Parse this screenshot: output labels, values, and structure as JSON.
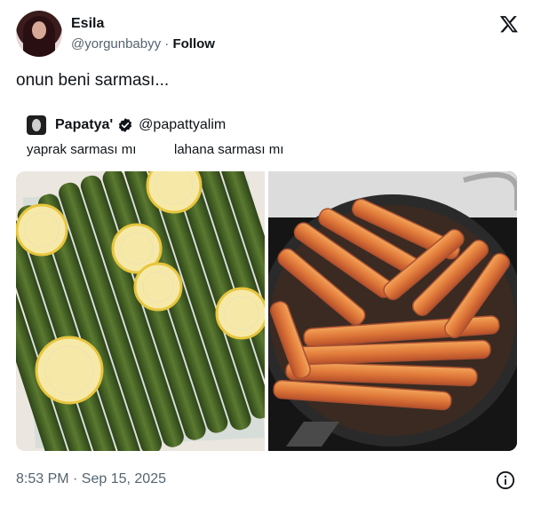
{
  "author": {
    "name": "Esila",
    "handle": "@yorgunbabyy",
    "separator": "·",
    "follow_label": "Follow"
  },
  "icons": {
    "x_logo": "x-logo-icon",
    "verified": "verified-badge-icon",
    "info": "info-icon"
  },
  "tweet": {
    "text": "onun beni sarması..."
  },
  "quoted": {
    "name": "Papatya'",
    "handle": "@papattyalim",
    "caption_left": "yaprak sarması mı",
    "caption_right": "lahana sarması mı"
  },
  "timestamp": "8:53 PM · Sep 15, 2025",
  "colors": {
    "text_primary": "#0f1419",
    "text_secondary": "#536471",
    "grape_leaf_green": "#3f5a22",
    "cabbage_orange": "#e07a3a",
    "lemon_yellow": "#f2d64b"
  }
}
